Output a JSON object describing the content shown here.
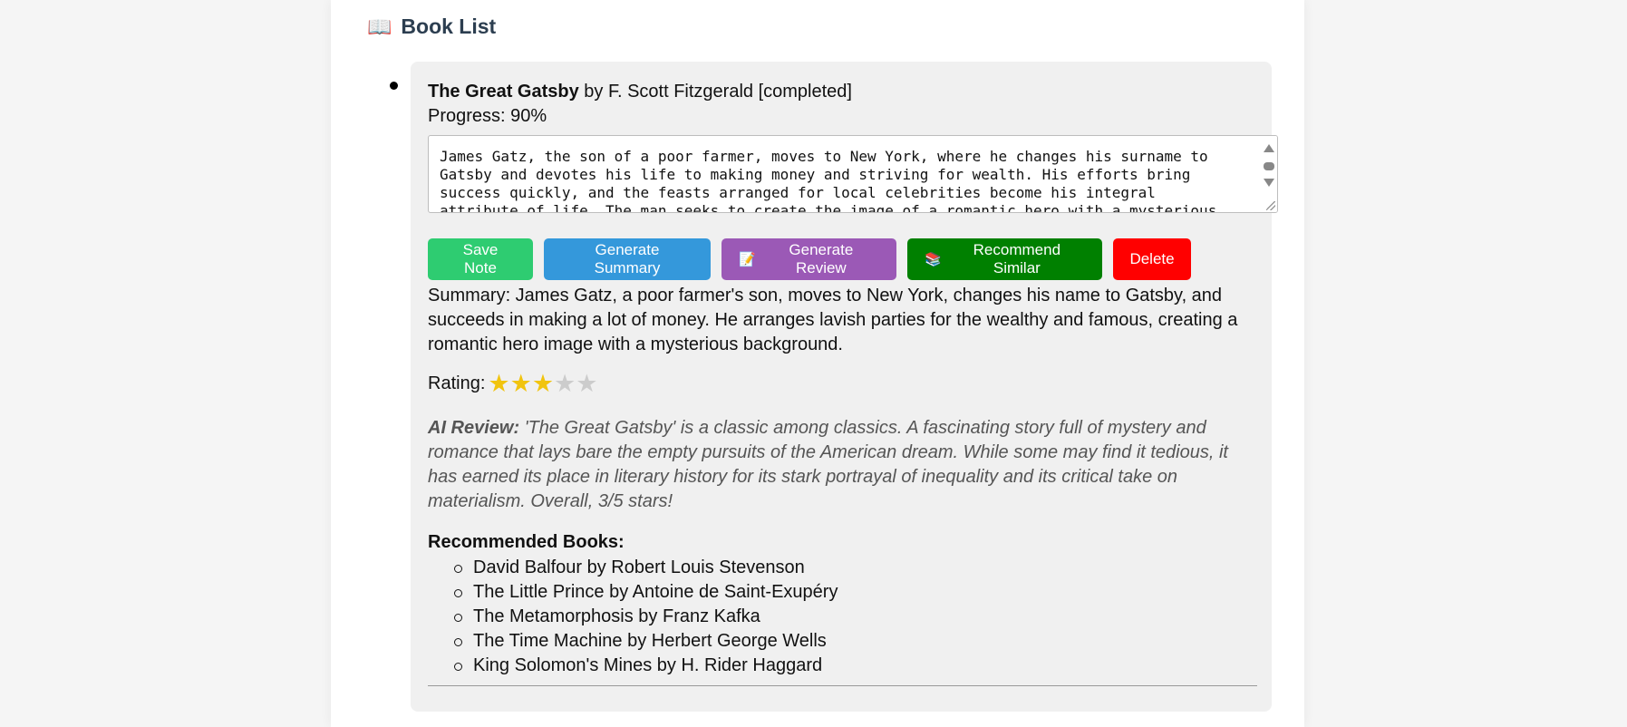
{
  "heading": {
    "icon": "open-book-icon",
    "title": "Book List"
  },
  "book": {
    "title": "The Great Gatsby",
    "by": "by F. Scott Fitzgerald [completed]",
    "progress_text": "Progress: 90%",
    "progress_percent": 90,
    "note": "James Gatz, the son of a poor farmer, moves to New York, where he changes his surname to Gatsby and devotes his life to making money and striving for wealth. His efforts bring success quickly, and the feasts arranged for local celebrities become his integral attribute of life. The man seeks to create the image of a romantic hero with a mysterious background",
    "buttons": {
      "save": "Save Note",
      "summary": "Generate Summary",
      "review": "Generate Review",
      "review_icon": "memo-icon",
      "recommend": "Recommend Similar",
      "recommend_icon": "books-icon",
      "delete": "Delete"
    },
    "summary": "Summary: James Gatz, a poor farmer's son, moves to New York, changes his name to Gatsby, and succeeds in making a lot of money. He arranges lavish parties for the wealthy and famous, creating a romantic hero image with a mysterious background.",
    "rating_label": "Rating:",
    "rating": 3,
    "rating_max": 5,
    "review_label": "AI Review:",
    "review": "'The Great Gatsby' is a classic among classics. A fascinating story full of mystery and romance that lays bare the empty pursuits of the American dream. While some may find it tedious, it has earned its place in literary history for its stark portrayal of inequality and its critical take on materialism. Overall, 3/5 stars!",
    "recommended_title": "Recommended Books:",
    "recommended": [
      "David Balfour by Robert Louis Stevenson",
      "The Little Prince by Antoine de Saint-Exupéry",
      "The Metamorphosis by Franz Kafka",
      "The Time Machine by Herbert George Wells",
      "King Solomon's Mines by H. Rider Haggard"
    ]
  },
  "colors": {
    "save": "#2ecc71",
    "summary": "#3498db",
    "review": "#9b59b6",
    "recommend": "#008000",
    "delete": "#ff0000",
    "star_filled": "#f1c40f",
    "star_empty": "#cccccc"
  }
}
